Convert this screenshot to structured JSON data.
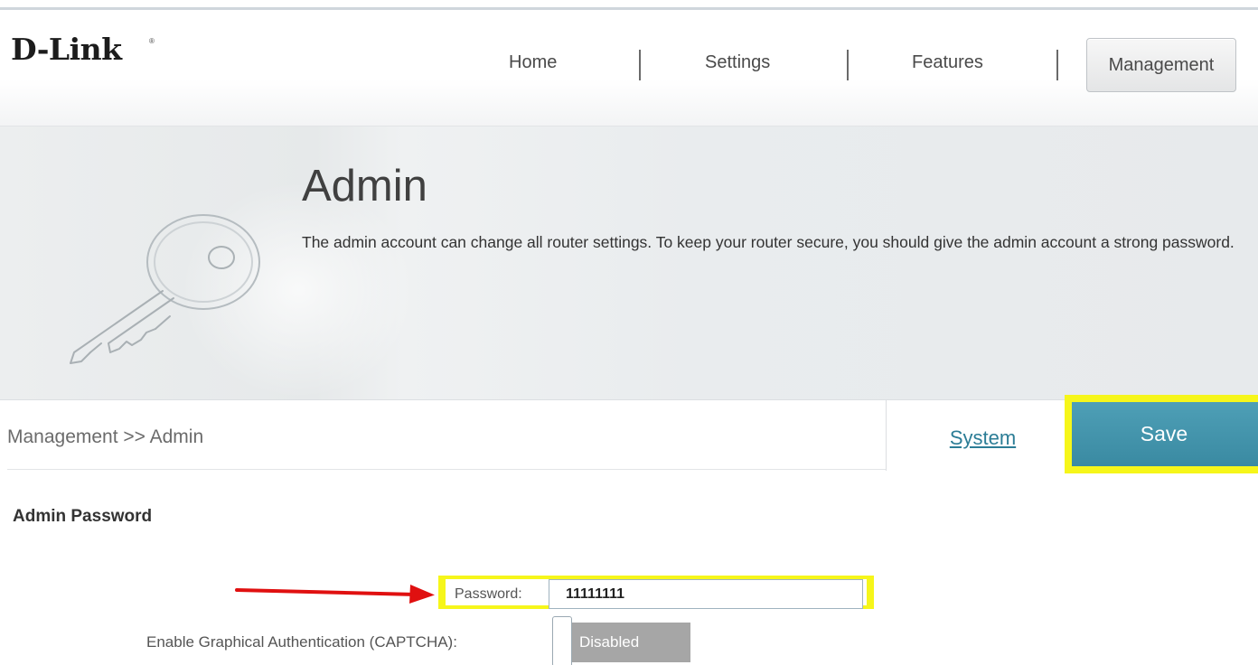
{
  "brand": {
    "logo_text": "D-Link",
    "registered_mark": "®"
  },
  "nav": {
    "items": [
      {
        "label": "Home"
      },
      {
        "label": "Settings"
      },
      {
        "label": "Features"
      }
    ],
    "active_label": "Management"
  },
  "banner": {
    "title": "Admin",
    "description": "The admin account can change all router settings. To keep your router secure, you should give the admin account a strong password.",
    "icon": "key-icon"
  },
  "toolbar": {
    "breadcrumb": "Management >> Admin",
    "system_link": "System",
    "save_label": "Save"
  },
  "admin_password": {
    "section_title": "Admin Password",
    "password_label": "Password:",
    "password_value": "11111111",
    "captcha_label": "Enable Graphical Authentication (CAPTCHA):",
    "captcha_state": "Disabled"
  },
  "colors": {
    "accent": "#3a8aa2",
    "highlight": "#f6f61a",
    "annotation_arrow": "#e01010",
    "link": "#2c7d96",
    "toggle_off": "#a6a6a6"
  }
}
